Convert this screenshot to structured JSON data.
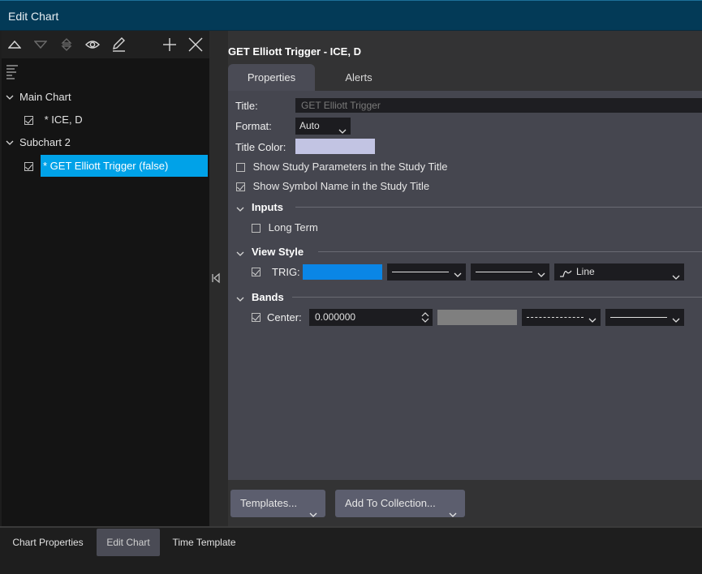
{
  "window": {
    "title": "Edit Chart"
  },
  "tree": {
    "main_chart": "Main Chart",
    "main_child": "* ICE, D",
    "subchart": "Subchart 2",
    "subchart_child": "* GET Elliott Trigger (false)"
  },
  "study": {
    "header": "GET Elliott Trigger - ICE, D",
    "tabs": [
      "Properties",
      "Alerts"
    ],
    "title_label": "Title:",
    "title_placeholder": "GET Elliott Trigger",
    "format_label": "Format:",
    "format_value": "Auto",
    "title_color_label": "Title Color:",
    "title_color": "#c2c4e3",
    "show_params": "Show Study Parameters in the Study Title",
    "show_params_checked": false,
    "show_symbol": "Show Symbol Name in the Study Title",
    "show_symbol_checked": true
  },
  "inputs": {
    "section": "Inputs",
    "long_term": "Long Term",
    "long_term_checked": false
  },
  "view_style": {
    "section": "View Style",
    "trig_label": "TRIG:",
    "trig_color": "#0a86e6",
    "trig_style": "Line"
  },
  "bands": {
    "section": "Bands",
    "center_label": "Center:",
    "center_value": "0.000000",
    "center_color": "#7f7f7f"
  },
  "buttons": {
    "templates": "Templates...",
    "add_to_collection": "Add To Collection..."
  },
  "bottom_tabs": [
    "Chart Properties",
    "Edit Chart",
    "Time Template"
  ]
}
